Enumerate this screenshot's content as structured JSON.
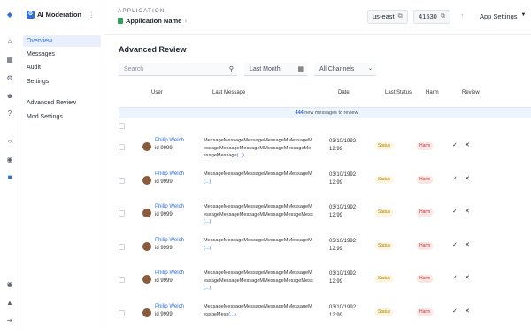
{
  "rail": {
    "icons": [
      "logo-icon",
      "home-icon",
      "grid-icon",
      "org-icon",
      "users-icon",
      "help-icon",
      "card-icon",
      "bell-icon",
      "globe-icon",
      "shield-icon",
      "user-circle-icon",
      "alert-icon",
      "logout-icon"
    ]
  },
  "sidebar": {
    "title": "AI Moderation",
    "items": [
      {
        "label": "Overview",
        "active": true
      },
      {
        "label": "Messages"
      },
      {
        "label": "Audit"
      },
      {
        "label": "Settings"
      },
      {
        "label": "Advanced Review"
      },
      {
        "label": "Mod Settings"
      }
    ]
  },
  "header": {
    "app_label": "APPLICATION",
    "app_name": "Application Name",
    "region": "us-east",
    "id": "41530",
    "app_settings": "App Settings"
  },
  "page": {
    "title": "Advanced Review",
    "search_placeholder": "Search",
    "date_filter": "Last Month",
    "channel_filter": "All Channels"
  },
  "table": {
    "columns": [
      "User",
      "Last Message",
      "Date",
      "Last Status",
      "Harm",
      "Review"
    ],
    "banner_count": "444",
    "banner_text": "new messages to review",
    "rows": [
      {
        "name": "Philip Welch",
        "id": "id 9999",
        "msg": "MessageMessageMessageMessageMMessageMessageMessageMessageMMessageMessageMessageMessage",
        "more": "(...)",
        "date": "03/10/1992",
        "time": "12:99",
        "status": "Status",
        "harm": "Harm"
      },
      {
        "name": "Philip Welch",
        "id": "id 9999",
        "msg": "MessageMessageMessageMessageMMessageM",
        "more": "(...)",
        "date": "03/10/1992",
        "time": "12:99",
        "status": "Status",
        "harm": "Harm"
      },
      {
        "name": "Philip Welch",
        "id": "id 9999",
        "msg": "MessageMessageMessageMessageMMessageMessageMessageMessageMMessageMessgeMess",
        "more": "(...)",
        "date": "03/10/1992",
        "time": "12:99",
        "status": "Status",
        "harm": "Harm"
      },
      {
        "name": "Philip Welch",
        "id": "id 9999",
        "msg": "MessageMessageMessageMessageMMessageM",
        "more": "(...)",
        "date": "03/10/1992",
        "time": "12:99",
        "status": "Status",
        "harm": "Harm"
      },
      {
        "name": "Philip Welch",
        "id": "id 9999",
        "msg": "MessageMessageMessageMessageMMessageMessageMessageMessageMMessageMessgeMess",
        "more": "(...)",
        "date": "03/10/1992",
        "time": "12:99",
        "status": "Status",
        "harm": "Harm"
      },
      {
        "name": "Philip Welch",
        "id": "id 9999",
        "msg": "MessageMessageMessageMessageMMessageMessgeMess",
        "more": "(...)",
        "date": "03/10/1992",
        "time": "12:99",
        "status": "Status",
        "harm": "Harm"
      }
    ]
  },
  "colors": {
    "accent": "#2f6fde",
    "status": "#b08400",
    "harm": "#c23a3a"
  }
}
